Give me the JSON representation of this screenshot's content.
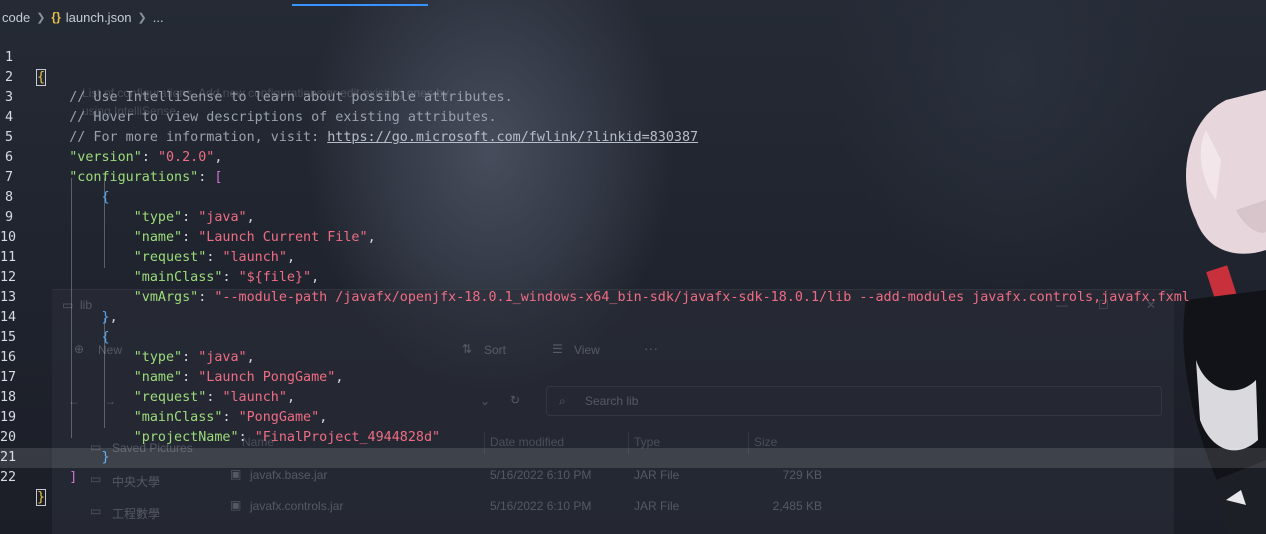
{
  "breadcrumb": {
    "folder": "code",
    "file_icon": "{}",
    "file": "launch.json",
    "tail": "..."
  },
  "editor": {
    "current_line": 22,
    "lines": [
      {
        "n": "1"
      },
      {
        "n": "2",
        "comment": "// Use IntelliSense to learn about possible attributes."
      },
      {
        "n": "3",
        "comment": "// Hover to view descriptions of existing attributes."
      },
      {
        "n": "4",
        "comment": "// For more information, visit: ",
        "url": "https://go.microsoft.com/fwlink/?linkid=830387"
      },
      {
        "n": "5",
        "key": "\"version\"",
        "value": "\"0.2.0\""
      },
      {
        "n": "6",
        "key": "\"configurations\""
      },
      {
        "n": "7"
      },
      {
        "n": "8",
        "key": "\"type\"",
        "value": "\"java\""
      },
      {
        "n": "9",
        "key": "\"name\"",
        "value": "\"Launch Current File\""
      },
      {
        "n": "10",
        "key": "\"request\"",
        "value": "\"launch\""
      },
      {
        "n": "11",
        "key": "\"mainClass\"",
        "value": "\"${file}\""
      },
      {
        "n": "12",
        "key": "\"vmArgs\"",
        "value": "\"--module-path /javafx/openjfx-18.0.1_windows-x64_bin-sdk/javafx-sdk-18.0.1/lib --add-modules javafx.controls,javafx.fxml"
      },
      {
        "n": "13"
      },
      {
        "n": "14"
      },
      {
        "n": "15",
        "key": "\"type\"",
        "value": "\"java\""
      },
      {
        "n": "16",
        "key": "\"name\"",
        "value": "\"Launch PongGame\""
      },
      {
        "n": "17",
        "key": "\"request\"",
        "value": "\"launch\""
      },
      {
        "n": "18",
        "key": "\"mainClass\"",
        "value": "\"PongGame\""
      },
      {
        "n": "19",
        "key": "\"projectName\"",
        "value": "\"FinalProject_4944828d\""
      },
      {
        "n": "20"
      },
      {
        "n": "21"
      },
      {
        "n": "22"
      }
    ]
  },
  "background_window": {
    "folder_title": "lib",
    "new_label": "New",
    "sort_label": "Sort",
    "view_label": "View",
    "more_label": "···",
    "search_placeholder": "Search lib",
    "columns": [
      "Name",
      "Date modified",
      "Type",
      "Size"
    ],
    "nav_items": [
      "Saved Pictures",
      "中央大學",
      "工程數學"
    ],
    "rows": [
      {
        "name": "javafx.base.jar",
        "date": "5/16/2022 6:10 PM",
        "type": "JAR File",
        "size": "729 KB"
      },
      {
        "name": "javafx.controls.jar",
        "date": "5/16/2022 6:10 PM",
        "type": "JAR File",
        "size": "2,485 KB"
      }
    ],
    "overlay_hint_1": "List of configurations. Add new configurations or edit existing ones by",
    "overlay_hint_2": "using IntelliSense."
  },
  "colors": {
    "key": "#9cdc7a",
    "string": "#ef6d84",
    "comment": "#9aa1ad",
    "accent_tab": "#3794ff"
  }
}
